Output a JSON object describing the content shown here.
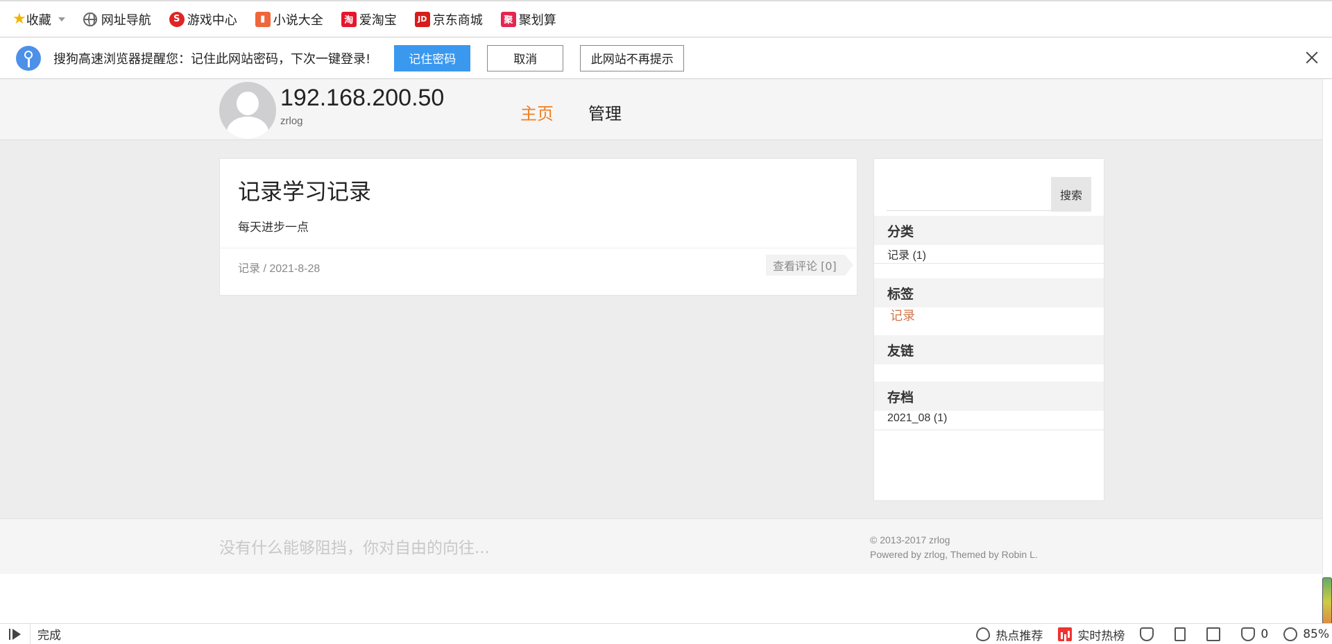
{
  "bookmarks": {
    "favorites_label": "收藏",
    "items": [
      {
        "label": "网址导航",
        "icon": "globe-icon"
      },
      {
        "label": "游戏中心",
        "icon": "game-icon",
        "color": "#e02424",
        "glyph": "S"
      },
      {
        "label": "小说大全",
        "icon": "novel-icon",
        "color": "#f0653a",
        "glyph": "▮"
      },
      {
        "label": "爱淘宝",
        "icon": "taobao-icon",
        "color": "#e6162d",
        "glyph": "淘"
      },
      {
        "label": "京东商城",
        "icon": "jd-icon",
        "color": "#d71c1c",
        "glyph": "JD"
      },
      {
        "label": "聚划算",
        "icon": "juhuasuan-icon",
        "color": "#e52650",
        "glyph": "聚"
      }
    ]
  },
  "password_prompt": {
    "message": "搜狗高速浏览器提醒您：记住此网站密码，下次一键登录!",
    "remember_label": "记住密码",
    "cancel_label": "取消",
    "never_label": "此网站不再提示"
  },
  "site": {
    "title": "192.168.200.50",
    "subtitle": "zrlog",
    "nav": {
      "home": "主页",
      "manage": "管理"
    }
  },
  "post": {
    "title": "记录学习记录",
    "description": "每天进步一点",
    "category": "记录",
    "date_sep": " / ",
    "date": "2021-8-28",
    "comments_label": "查看评论 [0]"
  },
  "sidebar": {
    "search_label": "搜索",
    "search_value": "",
    "categories_title": "分类",
    "category_item": "记录 (1)",
    "tags_title": "标签",
    "tag_item": "记录",
    "links_title": "友链",
    "archive_title": "存档",
    "archive_item": "2021_08 (1)"
  },
  "footer": {
    "slogan": "没有什么能够阻挡，你对自由的向往...",
    "copyright": "© 2013-2017 zrlog",
    "powered": "Powered by zrlog, Themed by Robin L."
  },
  "status_bar": {
    "status": "完成",
    "hot_recommend": "热点推荐",
    "realtime_hot": "实时热榜",
    "ad_count": "0",
    "zoom": "85%"
  },
  "colors": {
    "accent_orange": "#f27f22",
    "prompt_blue": "#3a98ef",
    "tag_color": "#d2754a"
  }
}
